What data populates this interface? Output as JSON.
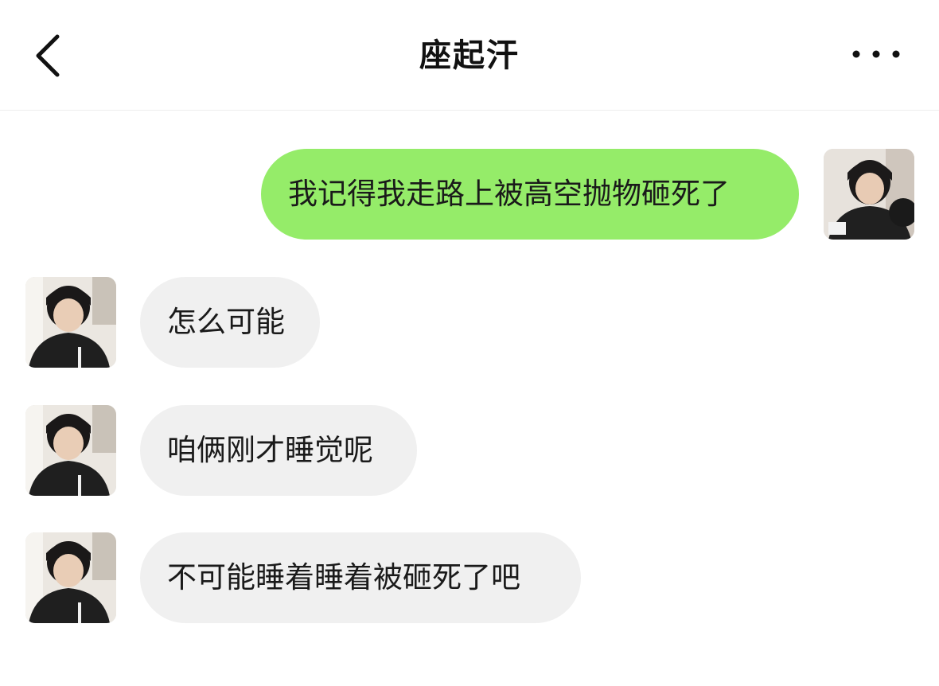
{
  "header": {
    "title": "座起汗",
    "back_icon": "chevron-left-icon",
    "more_icon": "more-horizontal-icon"
  },
  "colors": {
    "outgoing_bubble": "#95ec69",
    "incoming_bubble": "#f0f0f0",
    "text": "#1a1a1a"
  },
  "messages": [
    {
      "direction": "outgoing",
      "text": "我记得我走路上被高空抛物砸死了"
    },
    {
      "direction": "incoming",
      "text": "怎么可能"
    },
    {
      "direction": "incoming",
      "text": "咱俩刚才睡觉呢"
    },
    {
      "direction": "incoming",
      "text": "不可能睡着睡着被砸死了吧"
    }
  ]
}
